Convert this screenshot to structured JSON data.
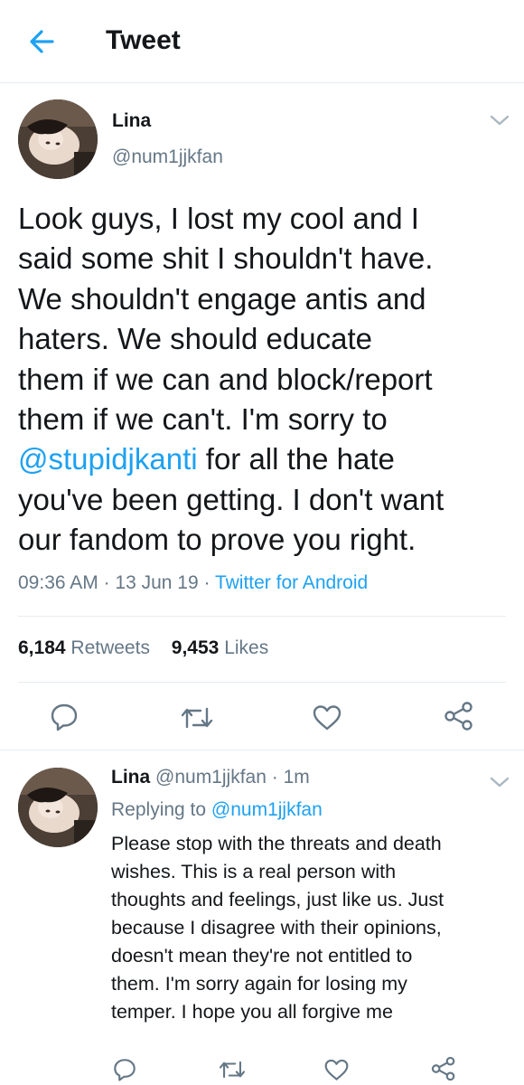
{
  "header": {
    "title": "Tweet",
    "back_icon": "arrow-left-icon",
    "accent_color": "#1da1f2"
  },
  "tweet": {
    "author_name": "Lina",
    "author_handle": "@num1jjkfan",
    "text_lines": [
      "Look guys, I lost my cool and I",
      "said some shit I shouldn't have.",
      "We shouldn't engage antis and",
      "haters. We should educate",
      "them if we can and block/report",
      "them if we can't. I'm sorry to"
    ],
    "mention": "@stupidjkanti",
    "mention_suffix": " for all the hate",
    "text_tail_lines": [
      "you've been getting. I don't want",
      "our fandom to prove you right."
    ],
    "time": "09:36 AM",
    "date": "13 Jun 19",
    "source": "Twitter for Android",
    "retweets_count": "6,184",
    "retweets_label": "Retweets",
    "likes_count": "9,453",
    "likes_label": "Likes"
  },
  "reply": {
    "author_name": "Lina",
    "author_handle": "@num1jjkfan",
    "age": "1m",
    "replying_label": "Replying to",
    "replying_to": "@num1jjkfan",
    "text_lines": [
      "Please stop with the threats and death",
      "wishes. This is a real person with",
      "thoughts and feelings, just like us. Just",
      "because I disagree with their opinions,",
      "doesn't mean they're not entitled to",
      "them. I'm sorry again for losing my",
      "temper. I hope you all forgive me"
    ]
  },
  "icons": {
    "reply": "comment-icon",
    "retweet": "retweet-icon",
    "like": "heart-icon",
    "share": "share-icon",
    "more": "chevron-down-icon"
  }
}
